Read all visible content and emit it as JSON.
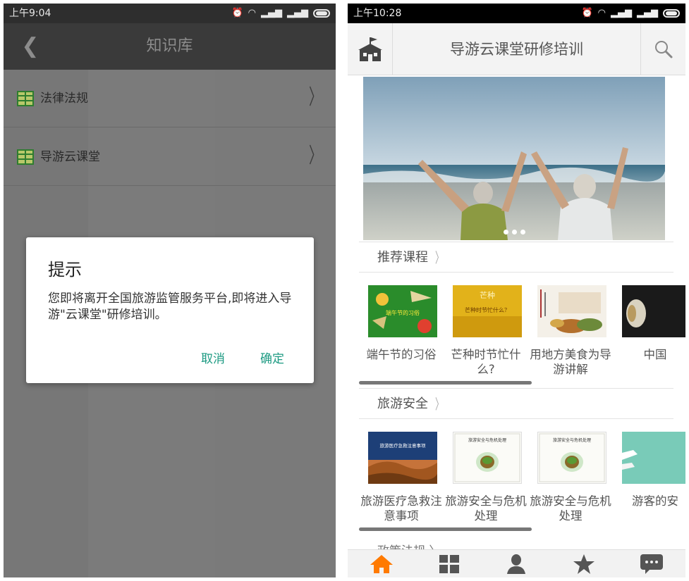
{
  "left_screen": {
    "status_time": "上午9:04",
    "nav_title": "知识库",
    "items": [
      {
        "label": "法律法规"
      },
      {
        "label": "导游云课堂"
      }
    ],
    "dialog": {
      "title": "提示",
      "message": "您即将离开全国旅游监管服务平台,即将进入导游\"云课堂\"研修培训。",
      "cancel": "取消",
      "confirm": "确定"
    },
    "colors": {
      "accent": "#1c9a82",
      "overlay": "#7b7b7b"
    }
  },
  "right_screen": {
    "status_time": "上午10:28",
    "nav_title": "导游云课堂研修培训",
    "banner_dots": 3,
    "sections": [
      {
        "title": "推荐课程",
        "courses": [
          {
            "title": "端午节的习俗",
            "thumb_text": "端午节的习俗"
          },
          {
            "title": "芒种时节忙什么?",
            "thumb_text": "芒种时节忙什么？"
          },
          {
            "title": "用地方美食为导游讲解",
            "thumb_text": ""
          },
          {
            "title": "中国",
            "thumb_text": ""
          }
        ]
      },
      {
        "title": "旅游安全",
        "courses": [
          {
            "title": "旅游医疗急救注意事项",
            "thumb_text": "旅游医疗急救注意事项"
          },
          {
            "title": "旅游安全与危机处理",
            "thumb_text": "旅游安全与危机处理"
          },
          {
            "title": "旅游安全与危机处理",
            "thumb_text": "旅游安全与危机处理"
          },
          {
            "title": "游客的安",
            "thumb_text": ""
          }
        ]
      }
    ],
    "next_section": "政策法规",
    "tabs": [
      "home-icon",
      "grid-icon",
      "user-icon",
      "star-icon",
      "message-icon"
    ],
    "colors": {
      "home_tab": "#ff7a00",
      "tab_icon": "#555555"
    }
  }
}
